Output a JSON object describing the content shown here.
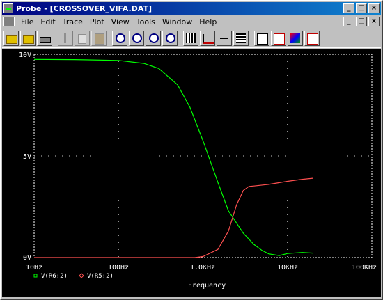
{
  "window": {
    "title": "Probe - [CROSSOVER_VIFA.DAT]",
    "controls": [
      "_",
      "□",
      "×"
    ],
    "doc_controls": [
      "_",
      "□",
      "×"
    ]
  },
  "menu": {
    "items": [
      "File",
      "Edit",
      "Trace",
      "Plot",
      "View",
      "Tools",
      "Window",
      "Help"
    ]
  },
  "toolbar": {
    "buttons": [
      "open-folder",
      "open-file",
      "print",
      "cut",
      "copy",
      "paste",
      "zoom-in",
      "zoom-out",
      "zoom-area",
      "zoom-fit",
      "add-plot",
      "fft",
      "performance-analysis",
      "table",
      "toggle-cursor",
      "eval-goal",
      "add-label",
      "mark-label"
    ]
  },
  "colors": {
    "background": "#000000",
    "axis": "#ffffff",
    "trace_green": "#00ff00",
    "trace_red": "#ff5050"
  },
  "chart_data": {
    "type": "line",
    "xscale": "log",
    "xlabel": "Frequency",
    "ylabel": "",
    "xlim": [
      10,
      100000
    ],
    "ylim": [
      0,
      10
    ],
    "xticks": [
      "10Hz",
      "100Hz",
      "1.0KHz",
      "10KHz",
      "100KHz"
    ],
    "yticks": [
      "0V",
      "5V",
      "10V"
    ],
    "grid": "dotted",
    "legend_position": "bottom-left",
    "series": [
      {
        "name": "V(R6:2)",
        "color": "#00ff00",
        "marker": "square",
        "x": [
          10,
          30,
          100,
          200,
          300,
          500,
          700,
          1000,
          1500,
          2000,
          3000,
          4000,
          5000,
          6000,
          8000,
          10000,
          15000,
          20000
        ],
        "y": [
          9.75,
          9.74,
          9.7,
          9.55,
          9.3,
          8.5,
          7.4,
          5.75,
          3.7,
          2.3,
          1.2,
          0.65,
          0.35,
          0.18,
          0.1,
          0.2,
          0.25,
          0.22
        ]
      },
      {
        "name": "V(R5:2)",
        "color": "#ff5050",
        "marker": "diamond",
        "x": [
          10,
          100,
          800,
          1000,
          1500,
          2000,
          2500,
          3000,
          3500,
          4000,
          6000,
          10000,
          15000,
          20000
        ],
        "y": [
          0,
          0,
          0,
          0.05,
          0.4,
          1.3,
          2.6,
          3.3,
          3.5,
          3.52,
          3.6,
          3.75,
          3.85,
          3.9
        ]
      }
    ]
  }
}
